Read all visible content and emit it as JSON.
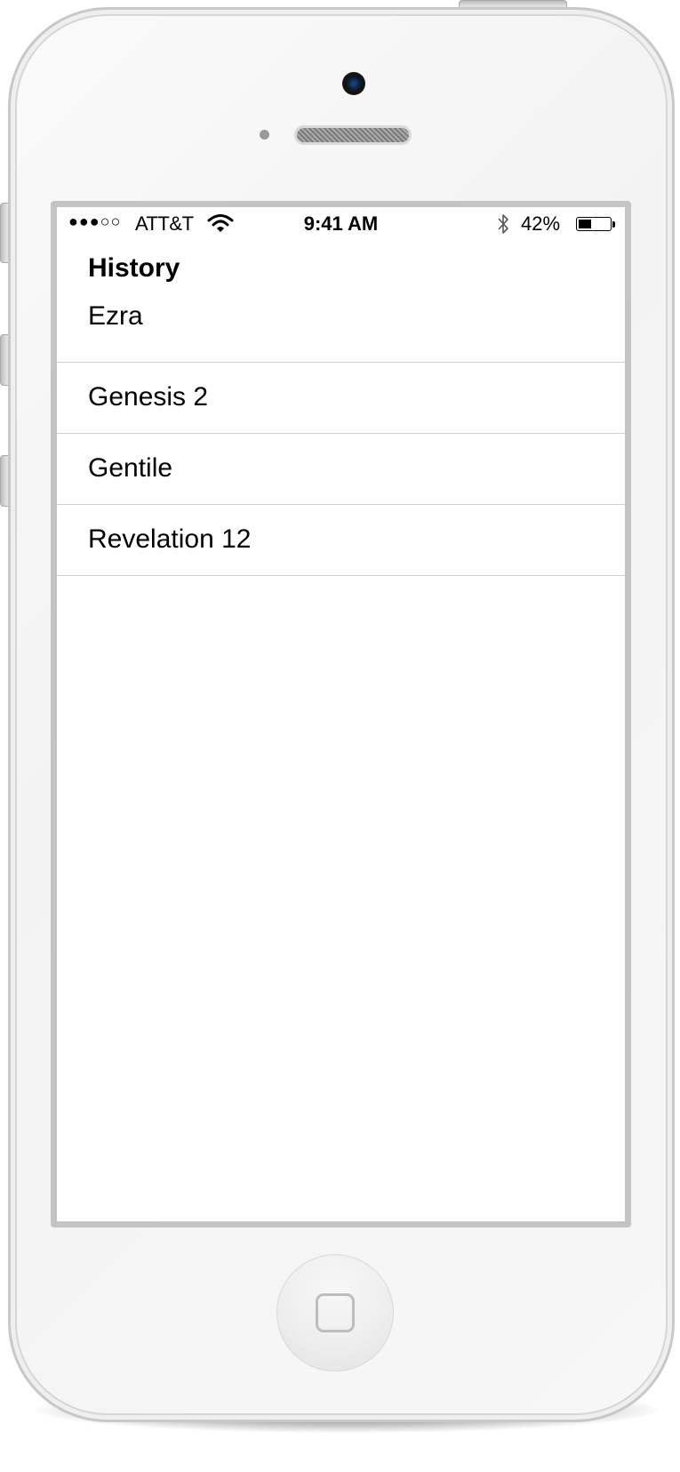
{
  "status_bar": {
    "signal": "●●●○○",
    "carrier": "ATT&T",
    "time": "9:41 AM",
    "battery_percent": "42%",
    "battery_level": 0.42,
    "wifi_icon": "wifi-icon",
    "bluetooth_icon": "bluetooth-icon"
  },
  "nav": {
    "title": "History"
  },
  "history": {
    "items": [
      {
        "label": "Ezra"
      },
      {
        "label": "Genesis 2"
      },
      {
        "label": "Gentile"
      },
      {
        "label": "Revelation 12"
      }
    ]
  }
}
